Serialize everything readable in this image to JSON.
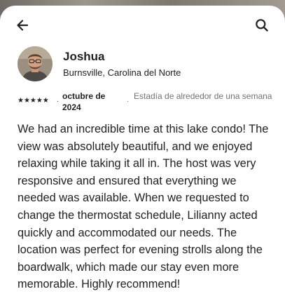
{
  "header": {
    "back_icon": "arrow-left-icon",
    "search_icon": "search-icon"
  },
  "reviewer": {
    "name": "Joshua",
    "location": "Burnsville, Carolina del Norte"
  },
  "review": {
    "rating": 5,
    "stars_text": "★★★★★",
    "separator": "·",
    "date": "octubre de 2024",
    "stay": "Estadía de alrededor de una semana",
    "text": "We had an incredible time at this lake condo! The view was absolutely beautiful, and we enjoyed relaxing while taking it all in. The host was very responsive and ensured that everything we needed was available. When we requested to change the thermostat schedule, Lilianny acted quickly and accommodated our needs. The location was perfect for evening strolls along the boardwalk, which made our stay even more memorable. Highly recommend!"
  },
  "colors": {
    "text_primary": "#222222",
    "text_secondary": "#717171",
    "sheet_background": "#ffffff"
  }
}
